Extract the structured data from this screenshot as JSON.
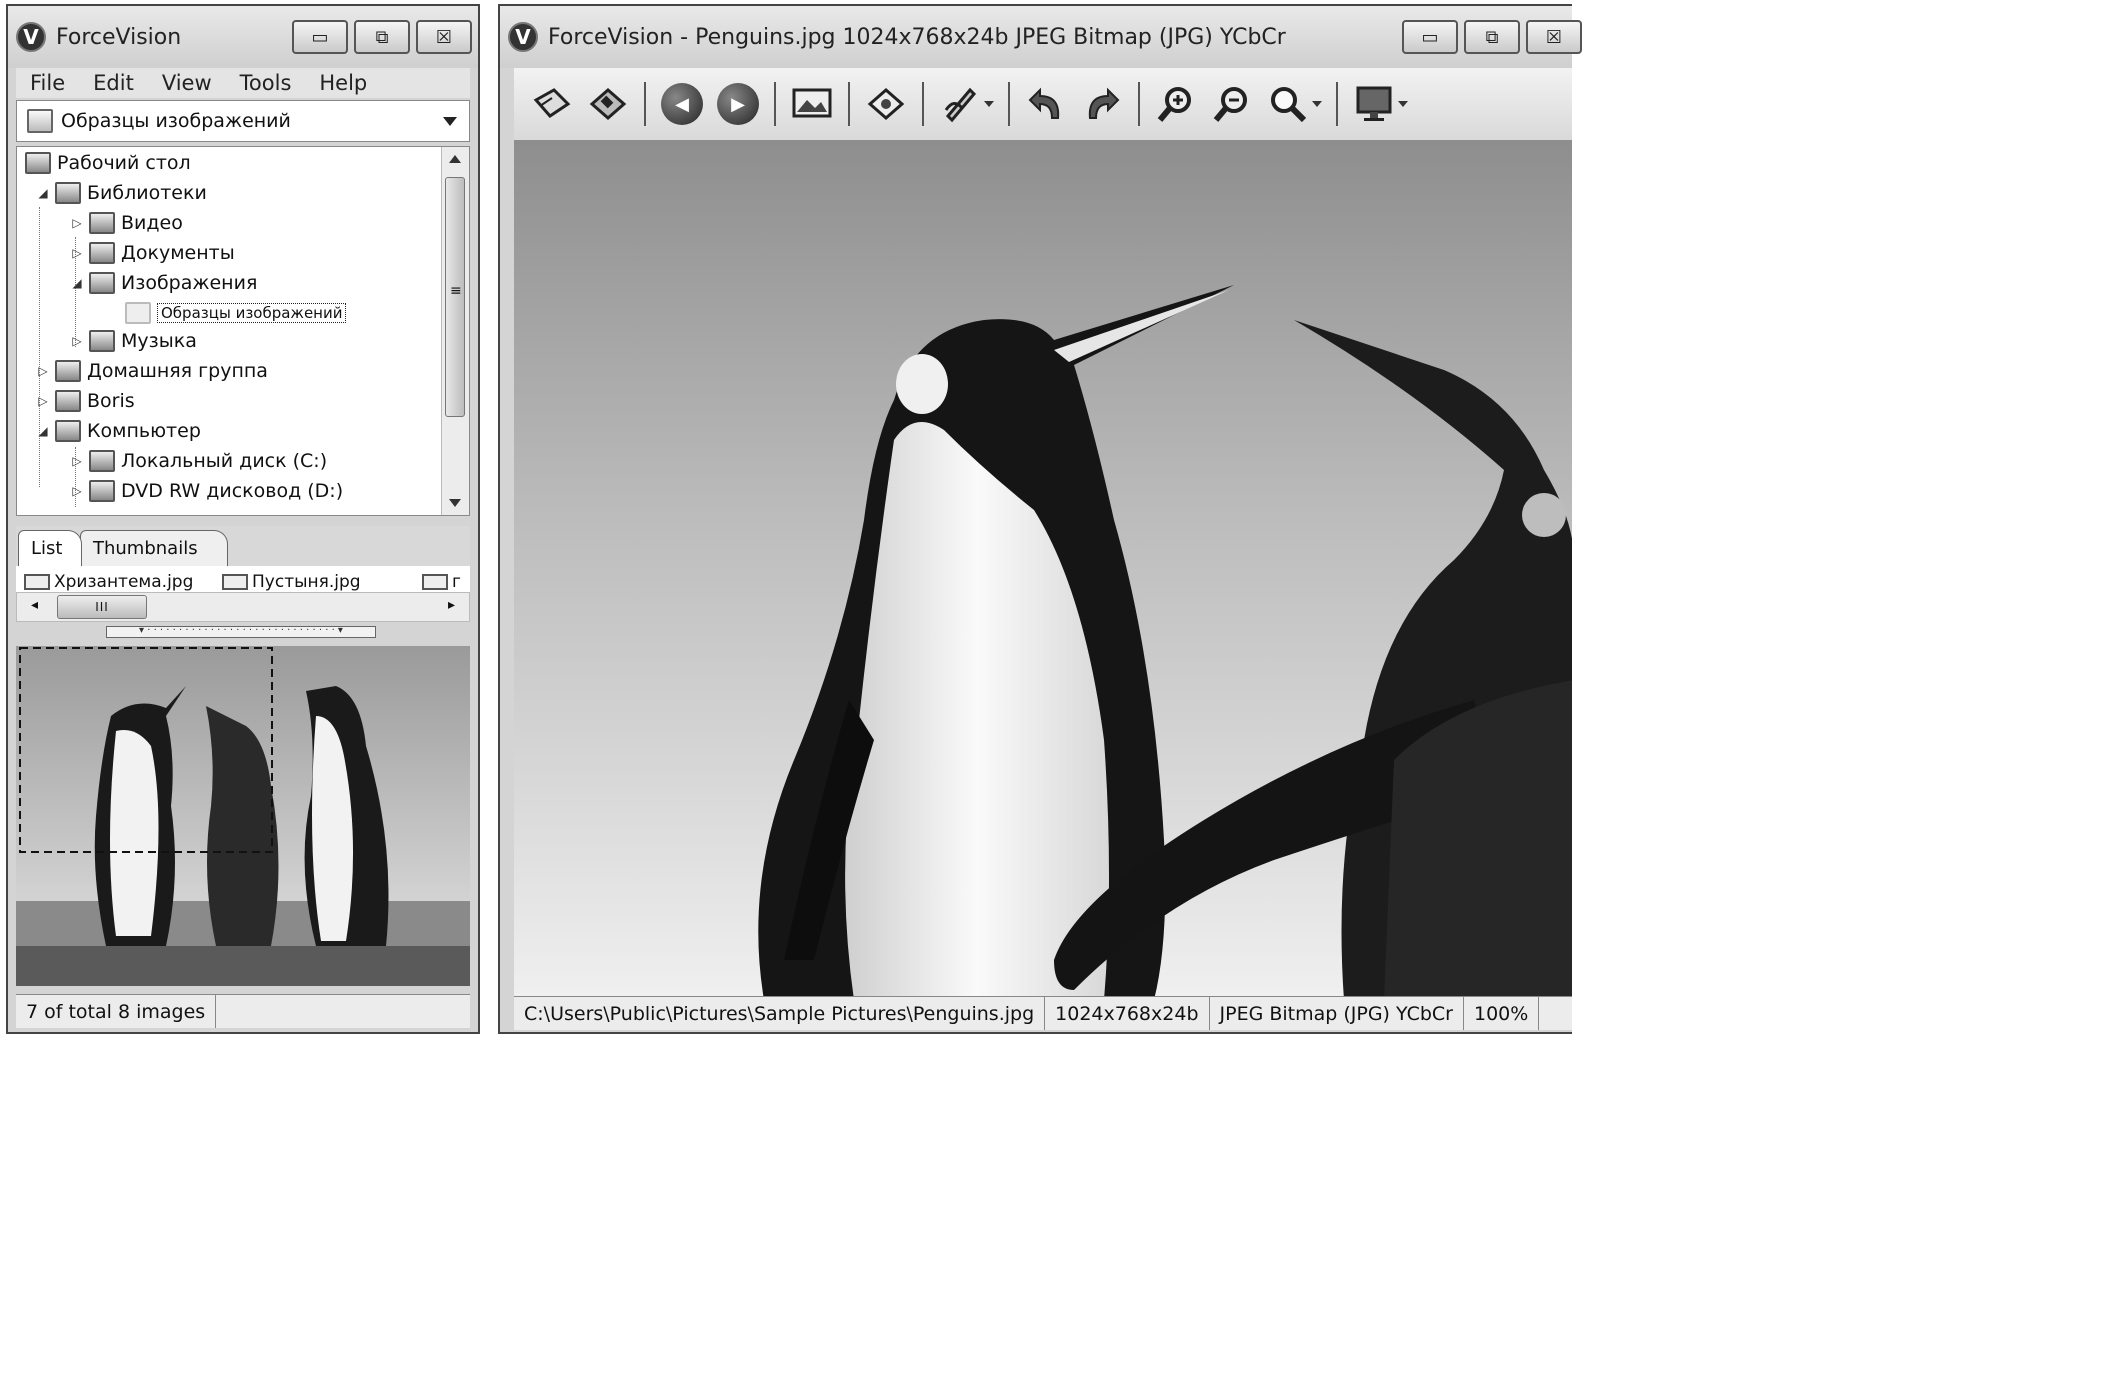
{
  "left_window": {
    "title": "ForceVision",
    "app_icon": "V",
    "menu": [
      "File",
      "Edit",
      "View",
      "Tools",
      "Help"
    ],
    "address": "Образцы изображений",
    "tree": [
      {
        "label": "Рабочий стол",
        "icon": "desktop-icon"
      },
      {
        "label": "Библиотеки",
        "icon": "libraries-icon"
      },
      {
        "label": "Видео",
        "icon": "video-icon"
      },
      {
        "label": "Документы",
        "icon": "documents-icon"
      },
      {
        "label": "Изображения",
        "icon": "pictures-icon"
      },
      {
        "label": "Образцы изображений",
        "icon": "folder-icon"
      },
      {
        "label": "Музыка",
        "icon": "music-icon"
      },
      {
        "label": "Домашняя группа",
        "icon": "homegroup-icon"
      },
      {
        "label": "Boris",
        "icon": "user-icon"
      },
      {
        "label": "Компьютер",
        "icon": "computer-icon"
      },
      {
        "label": "Локальный диск (C:)",
        "icon": "local-disk-icon"
      },
      {
        "label": "DVD RW дисковод (D:)",
        "icon": "dvd-drive-icon"
      }
    ],
    "tabs": [
      "List",
      "Thumbnails"
    ],
    "list_items": [
      "Хризантема.jpg",
      "Пустыня.jpg",
      "г"
    ],
    "scroll_grip": "III",
    "status": "7 of total 8 images"
  },
  "right_window": {
    "title": "ForceVision - Penguins.jpg  1024x768x24b  JPEG Bitmap (JPG) YCbCr",
    "app_icon": "V",
    "toolbar_icons": [
      "open-icon",
      "save-icon",
      "previous-icon",
      "next-icon",
      "slideshow-icon",
      "browse-icon",
      "edit-icon",
      "undo-icon",
      "redo-icon",
      "zoom-in-icon",
      "zoom-out-icon",
      "zoom-icon",
      "fullscreen-icon"
    ],
    "status": {
      "path": "C:\\Users\\Public\\Pictures\\Sample Pictures\\Penguins.jpg",
      "dimensions": "1024x768x24b",
      "format": "JPEG Bitmap (JPG) YCbCr",
      "zoom": "100%"
    }
  },
  "window_controls": {
    "minimize": "▭",
    "maximize": "⧉",
    "close": "☒"
  },
  "colors": {
    "chrome": "#d4d4d4",
    "titlebar": "#dcdcdc",
    "tree_bg": "#ffffff"
  }
}
